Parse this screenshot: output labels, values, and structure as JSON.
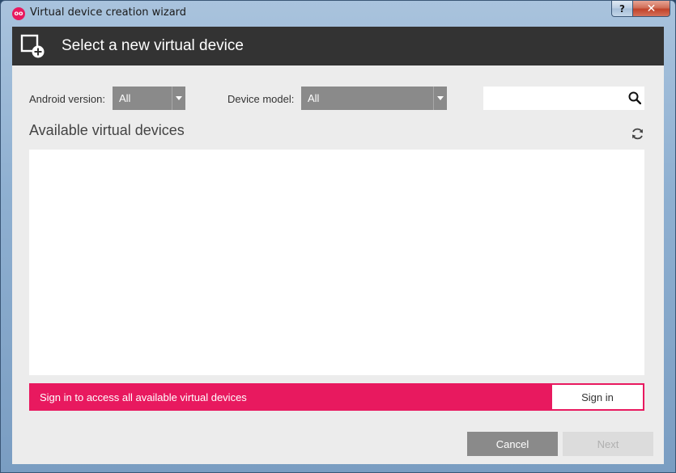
{
  "window": {
    "title": "Virtual device creation wizard",
    "logo_text": "oo",
    "help_label": "?",
    "close_label": "✕"
  },
  "header": {
    "title": "Select a new virtual device",
    "icon": "add-device-icon"
  },
  "filters": {
    "android_version_label": "Android version:",
    "android_version_value": "All",
    "device_model_label": "Device model:",
    "device_model_value": "All",
    "search_value": "",
    "search_icon": "search-icon"
  },
  "devices": {
    "section_title": "Available virtual devices",
    "refresh_icon": "refresh-icon",
    "items": []
  },
  "signin": {
    "message": "Sign in to access all available virtual devices",
    "button_label": "Sign in"
  },
  "footer": {
    "cancel_label": "Cancel",
    "next_label": "Next"
  },
  "colors": {
    "header_bg": "#333333",
    "accent": "#e8195f",
    "combo_bg": "#8a8a8a"
  }
}
